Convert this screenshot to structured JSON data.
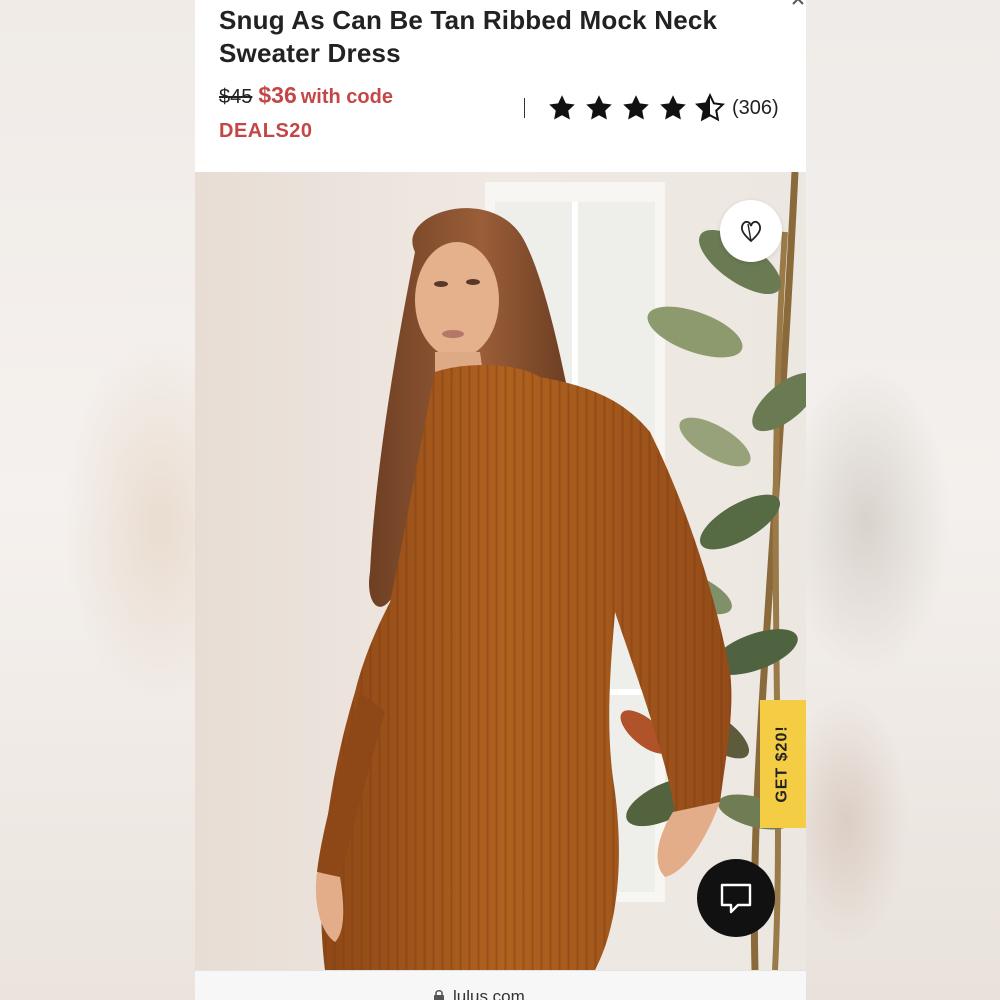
{
  "product": {
    "title": "Snug As Can Be Tan Ribbed Mock Neck Sweater Dress",
    "old_price": "$45",
    "new_price": "$36",
    "with_code": "with code",
    "promo_code": "DEALS20",
    "rating": 4.5,
    "review_count": "(306)"
  },
  "hero": {
    "wishlist_icon": "heart-icon",
    "promo_tab_label": "GET $20!",
    "chat_icon": "chat-bubble-icon"
  },
  "browser": {
    "url": "lulus.com",
    "lock_icon": "lock-icon"
  },
  "colors": {
    "sale_red": "#c44747",
    "promo_yellow": "#f5cd44",
    "dress_rust": "#a3571f"
  }
}
